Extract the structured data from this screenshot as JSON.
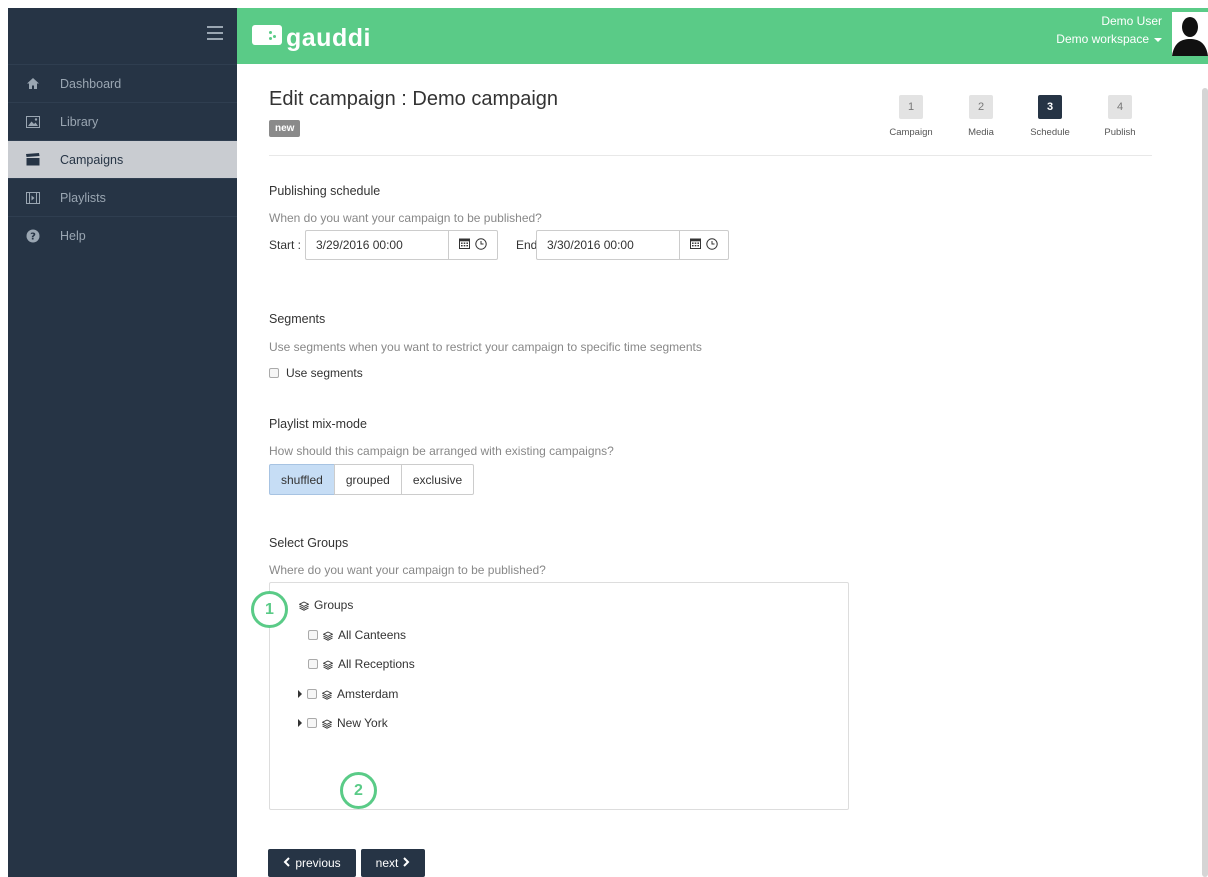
{
  "brand": {
    "name": "gauddi",
    "header_color": "#5acb87",
    "sidebar_color": "#263445"
  },
  "user": {
    "name": "Demo User",
    "workspace": "Demo workspace"
  },
  "sidebar": {
    "items": [
      {
        "label": "Dashboard",
        "icon": "home-icon"
      },
      {
        "label": "Library",
        "icon": "image-icon"
      },
      {
        "label": "Campaigns",
        "icon": "clapperboard-icon",
        "active": true
      },
      {
        "label": "Playlists",
        "icon": "film-icon"
      },
      {
        "label": "Help",
        "icon": "question-circle-icon"
      }
    ]
  },
  "page": {
    "title": "Edit campaign : Demo campaign",
    "badge": "new"
  },
  "steps": [
    {
      "num": "1",
      "label": "Campaign"
    },
    {
      "num": "2",
      "label": "Media"
    },
    {
      "num": "3",
      "label": "Schedule",
      "active": true
    },
    {
      "num": "4",
      "label": "Publish"
    }
  ],
  "schedule": {
    "title": "Publishing schedule",
    "description": "When do you want your campaign to be published?",
    "start_label": "Start :",
    "start_value": "3/29/2016 00:00",
    "end_label": "End:",
    "end_value": "3/30/2016 00:00"
  },
  "segments": {
    "title": "Segments",
    "description": "Use segments when you want to restrict your campaign to specific time segments",
    "checkbox_label": "Use segments"
  },
  "mix_mode": {
    "title": "Playlist mix-mode",
    "description": "How should this campaign be arranged with existing campaigns?",
    "options": [
      "shuffled",
      "grouped",
      "exclusive"
    ],
    "selected": "shuffled"
  },
  "groups": {
    "title": "Select Groups",
    "description": "Where do you want your campaign to be published?",
    "root": "Groups",
    "children": [
      "All Canteens",
      "All Receptions",
      "Amsterdam",
      "New York"
    ]
  },
  "callouts": [
    "1",
    "2"
  ],
  "buttons": {
    "previous": "previous",
    "next": "next"
  }
}
